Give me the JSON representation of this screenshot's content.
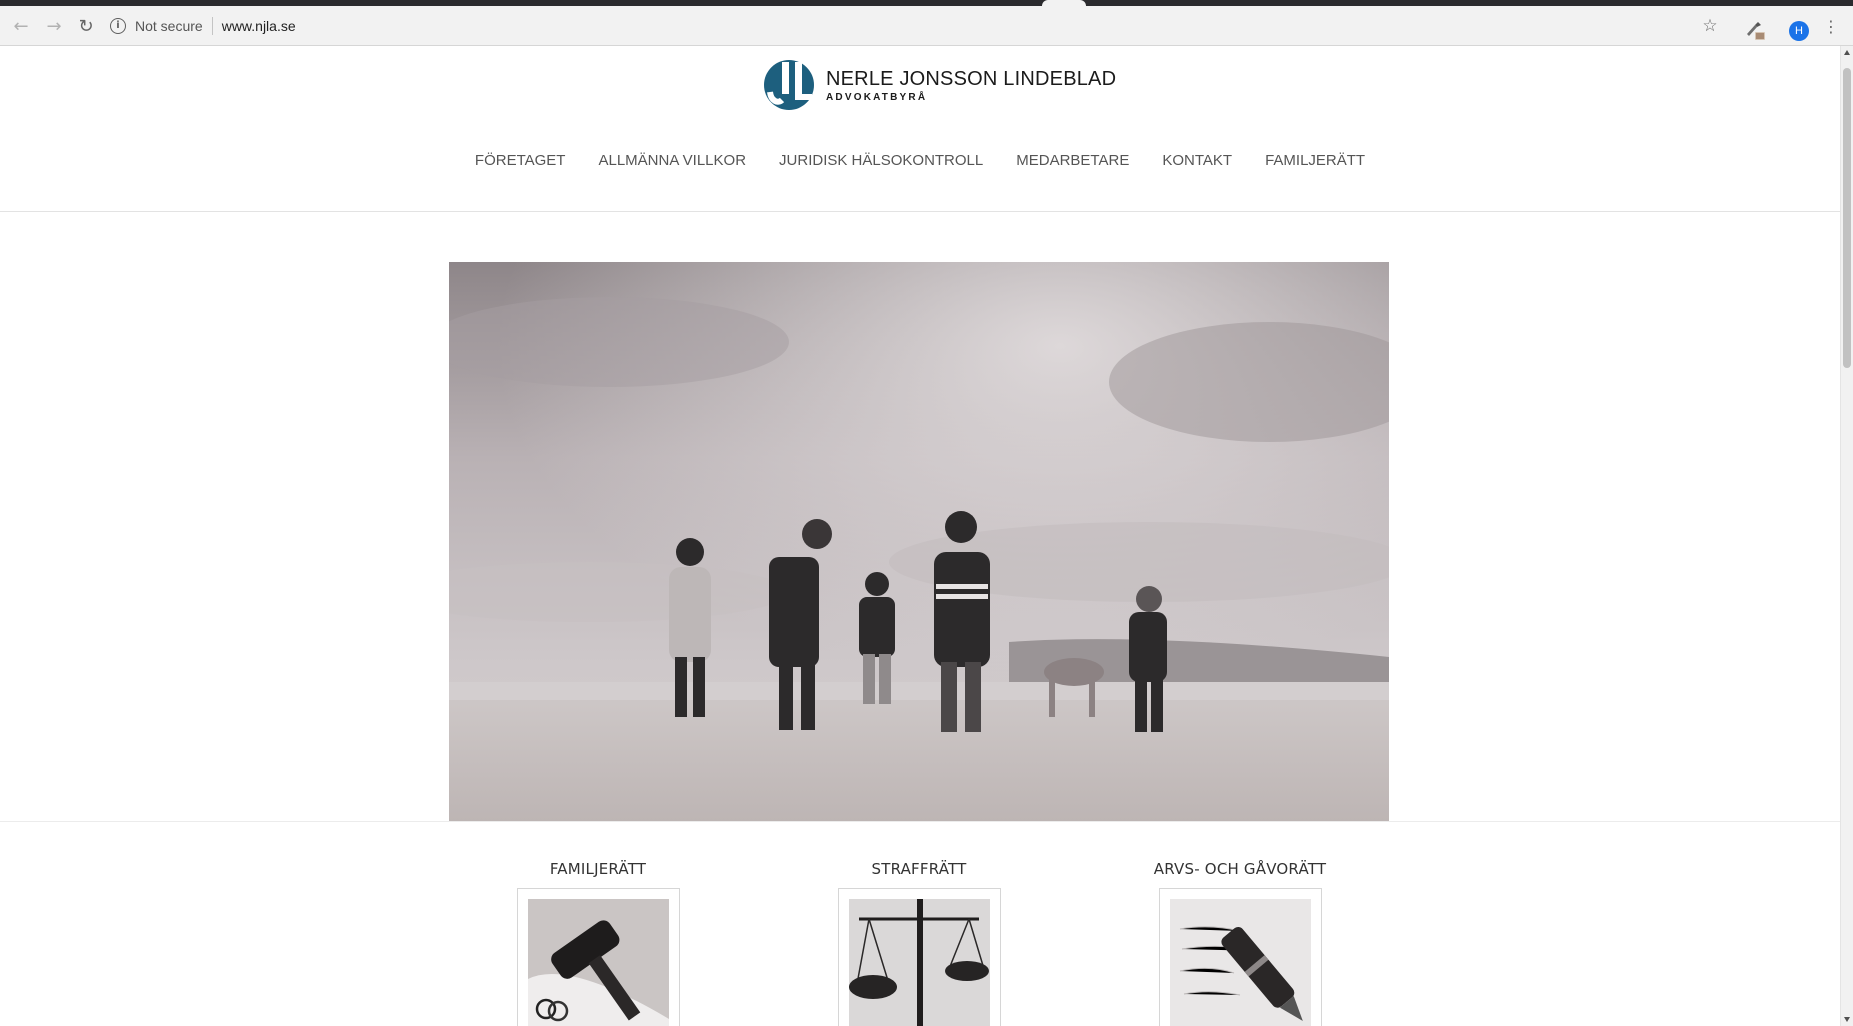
{
  "browser": {
    "security_label": "Not secure",
    "url": "www.njla.se",
    "avatar_initial": "H",
    "icons": [
      "back-arrow-icon",
      "forward-arrow-icon",
      "reload-icon",
      "info-icon",
      "star-icon",
      "extension-icon",
      "menu-dots-icon"
    ]
  },
  "site": {
    "logo_name": "NERLE JONSSON LINDEBLAD",
    "logo_sub": "ADVOKATBYRÅ",
    "brand_color": "#1d5f7e",
    "nav": [
      {
        "label": "FÖRETAGET"
      },
      {
        "label": "ALLMÄNNA VILLKOR"
      },
      {
        "label": "JURIDISK HÄLSOKONTROLL"
      },
      {
        "label": "MEDARBETARE"
      },
      {
        "label": "KONTAKT"
      },
      {
        "label": "FAMILJERÄTT"
      }
    ]
  },
  "services": [
    {
      "title": "FAMILJERÄTT",
      "image": "gavel-with-rings"
    },
    {
      "title": "STRAFFRÄTT",
      "image": "scales-of-justice"
    },
    {
      "title": "ARVS- OCH GÅVORÄTT",
      "image": "fountain-pen"
    }
  ]
}
